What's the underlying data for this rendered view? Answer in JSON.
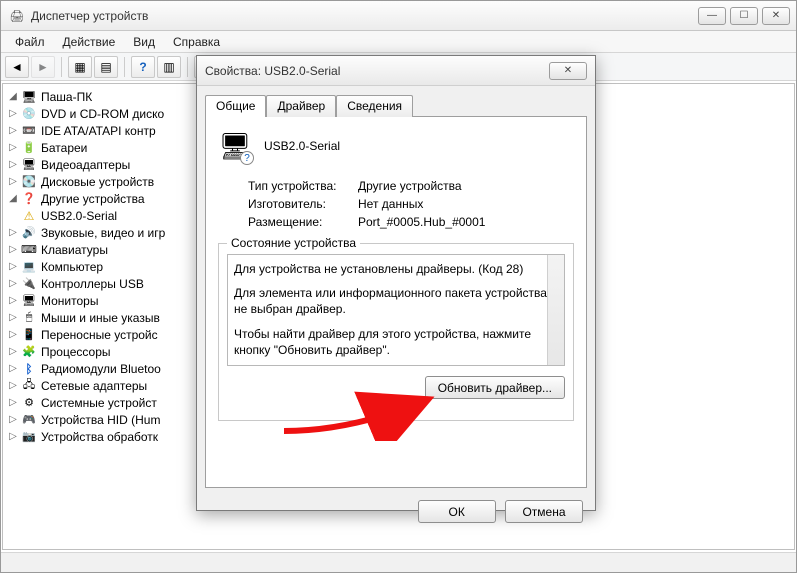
{
  "window": {
    "title": "Диспетчер устройств",
    "min": "—",
    "max": "☐",
    "close": "✕"
  },
  "menu": {
    "file": "Файл",
    "action": "Действие",
    "view": "Вид",
    "help": "Справка"
  },
  "tree": {
    "root": "Паша-ПК",
    "items": [
      "DVD и CD-ROM диско",
      "IDE ATA/ATAPI контр",
      "Батареи",
      "Видеоадаптеры",
      "Дисковые устройств",
      "Другие устройства",
      "Звуковые, видео и игр",
      "Клавиатуры",
      "Компьютер",
      "Контроллеры USB",
      "Мониторы",
      "Мыши и иные указыв",
      "Переносные устройс",
      "Процессоры",
      "Радиомодули Bluetoo",
      "Сетевые адаптеры",
      "Системные устройст",
      "Устройства HID (Hum",
      "Устройства обработк"
    ],
    "other_child": "USB2.0-Serial"
  },
  "dialog": {
    "title": "Свойства: USB2.0-Serial",
    "tabs": {
      "general": "Общие",
      "driver": "Драйвер",
      "details": "Сведения"
    },
    "device_name": "USB2.0-Serial",
    "type_label": "Тип устройства:",
    "type_value": "Другие устройства",
    "mfg_label": "Изготовитель:",
    "mfg_value": "Нет данных",
    "loc_label": "Размещение:",
    "loc_value": "Port_#0005.Hub_#0001",
    "status_legend": "Состояние устройства",
    "status_line1": "Для устройства не установлены драйверы. (Код 28)",
    "status_line2": "Для элемента или информационного пакета устройства не выбран драйвер.",
    "status_line3": "Чтобы найти драйвер для этого устройства, нажмите кнопку \"Обновить драйвер\".",
    "update_btn": "Обновить драйвер...",
    "ok": "ОК",
    "cancel": "Отмена"
  }
}
